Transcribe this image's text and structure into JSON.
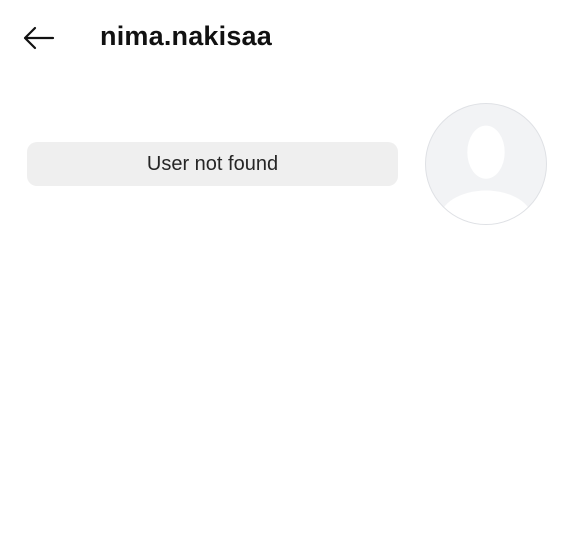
{
  "header": {
    "back_icon": "back-arrow-icon",
    "username": "nima.nakisaa"
  },
  "profile": {
    "status_text": "User not found",
    "avatar_icon": "default-avatar-icon"
  },
  "colors": {
    "background": "#ffffff",
    "pill_background": "#efefef",
    "avatar_background": "#f2f3f5",
    "avatar_figure": "#ffffff",
    "text_primary": "#111111"
  }
}
